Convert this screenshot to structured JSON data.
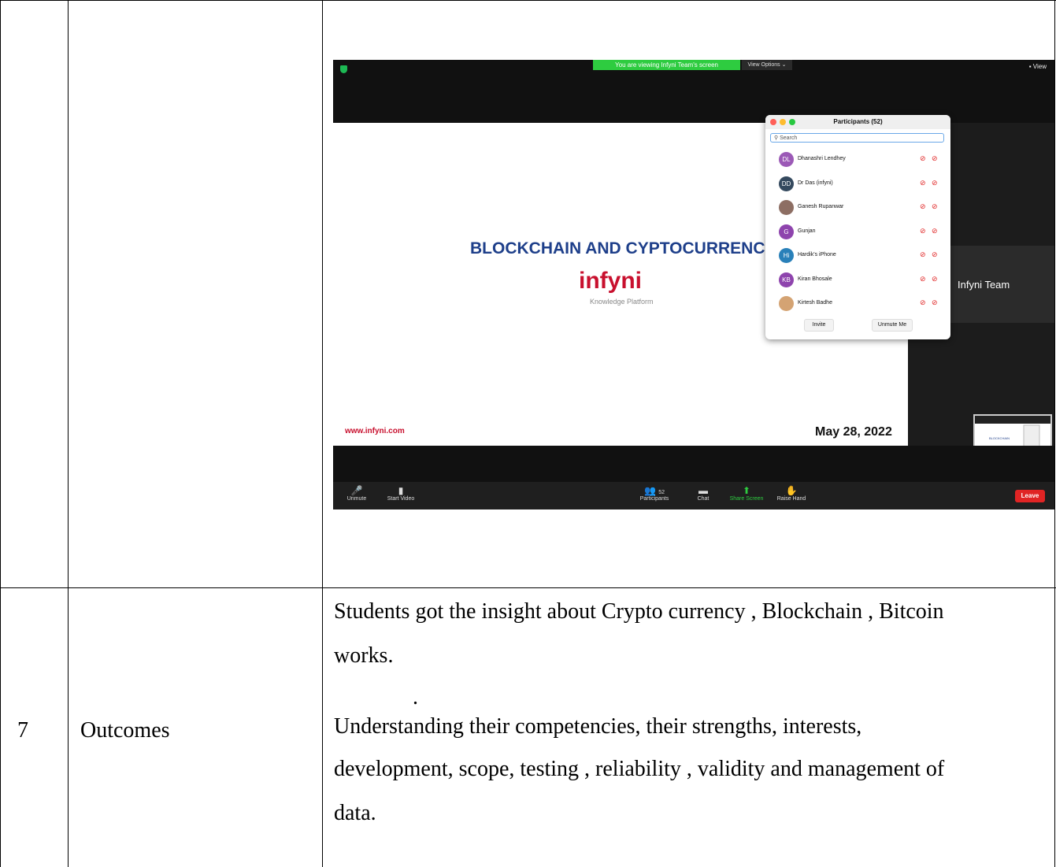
{
  "outcomes_row": {
    "number": "7",
    "label": "Outcomes",
    "para1": "Students got the insight about Crypto currency , Blockchain , Bitcoin",
    "para1b": "works.",
    "dot": ".",
    "para2a": "Understanding their competencies, their strengths, interests,",
    "para2b": "development, scope, testing , reliability , validity and management of",
    "para2c": "data."
  },
  "zoom": {
    "banner": "You are viewing Infyni Team's screen",
    "view_options": "View Options ⌄",
    "view": "View",
    "slide_title": "BLOCKCHAIN AND CYPTOCURRENCY",
    "slide_logo": "infyni",
    "slide_logo_sub": "Knowledge Platform",
    "slide_url": "www.infyni.com",
    "slide_date": "May 28, 2022",
    "team_name": "Infyni Team",
    "toolbar": {
      "unmute": "Unmute",
      "start_video": "Start Video",
      "participants_count": "52",
      "participants": "Participants",
      "chat": "Chat",
      "share_screen": "Share Screen",
      "raise_hand": "Raise Hand",
      "leave": "Leave"
    },
    "panel": {
      "title": "Participants (52)",
      "search_placeholder": "Search",
      "invite": "Invite",
      "unmute_me": "Unmute Me",
      "participants": [
        {
          "initials": "DL",
          "name": "Dhanashri Lendhey",
          "color": "#9b59b6"
        },
        {
          "initials": "DD",
          "name": "Dr Das (infyni)",
          "color": "#34495e"
        },
        {
          "initials": "",
          "name": "Ganesh Rupanwar",
          "color": "#8d6e63"
        },
        {
          "initials": "G",
          "name": "Gunjan",
          "color": "#8e44ad"
        },
        {
          "initials": "Hi",
          "name": "Hardik's iPhone",
          "color": "#2980b9"
        },
        {
          "initials": "KB",
          "name": "Kiran Bhosale",
          "color": "#8e44ad"
        },
        {
          "initials": "",
          "name": "Kirtesh Badhe",
          "color": "#d4a373"
        }
      ]
    }
  }
}
